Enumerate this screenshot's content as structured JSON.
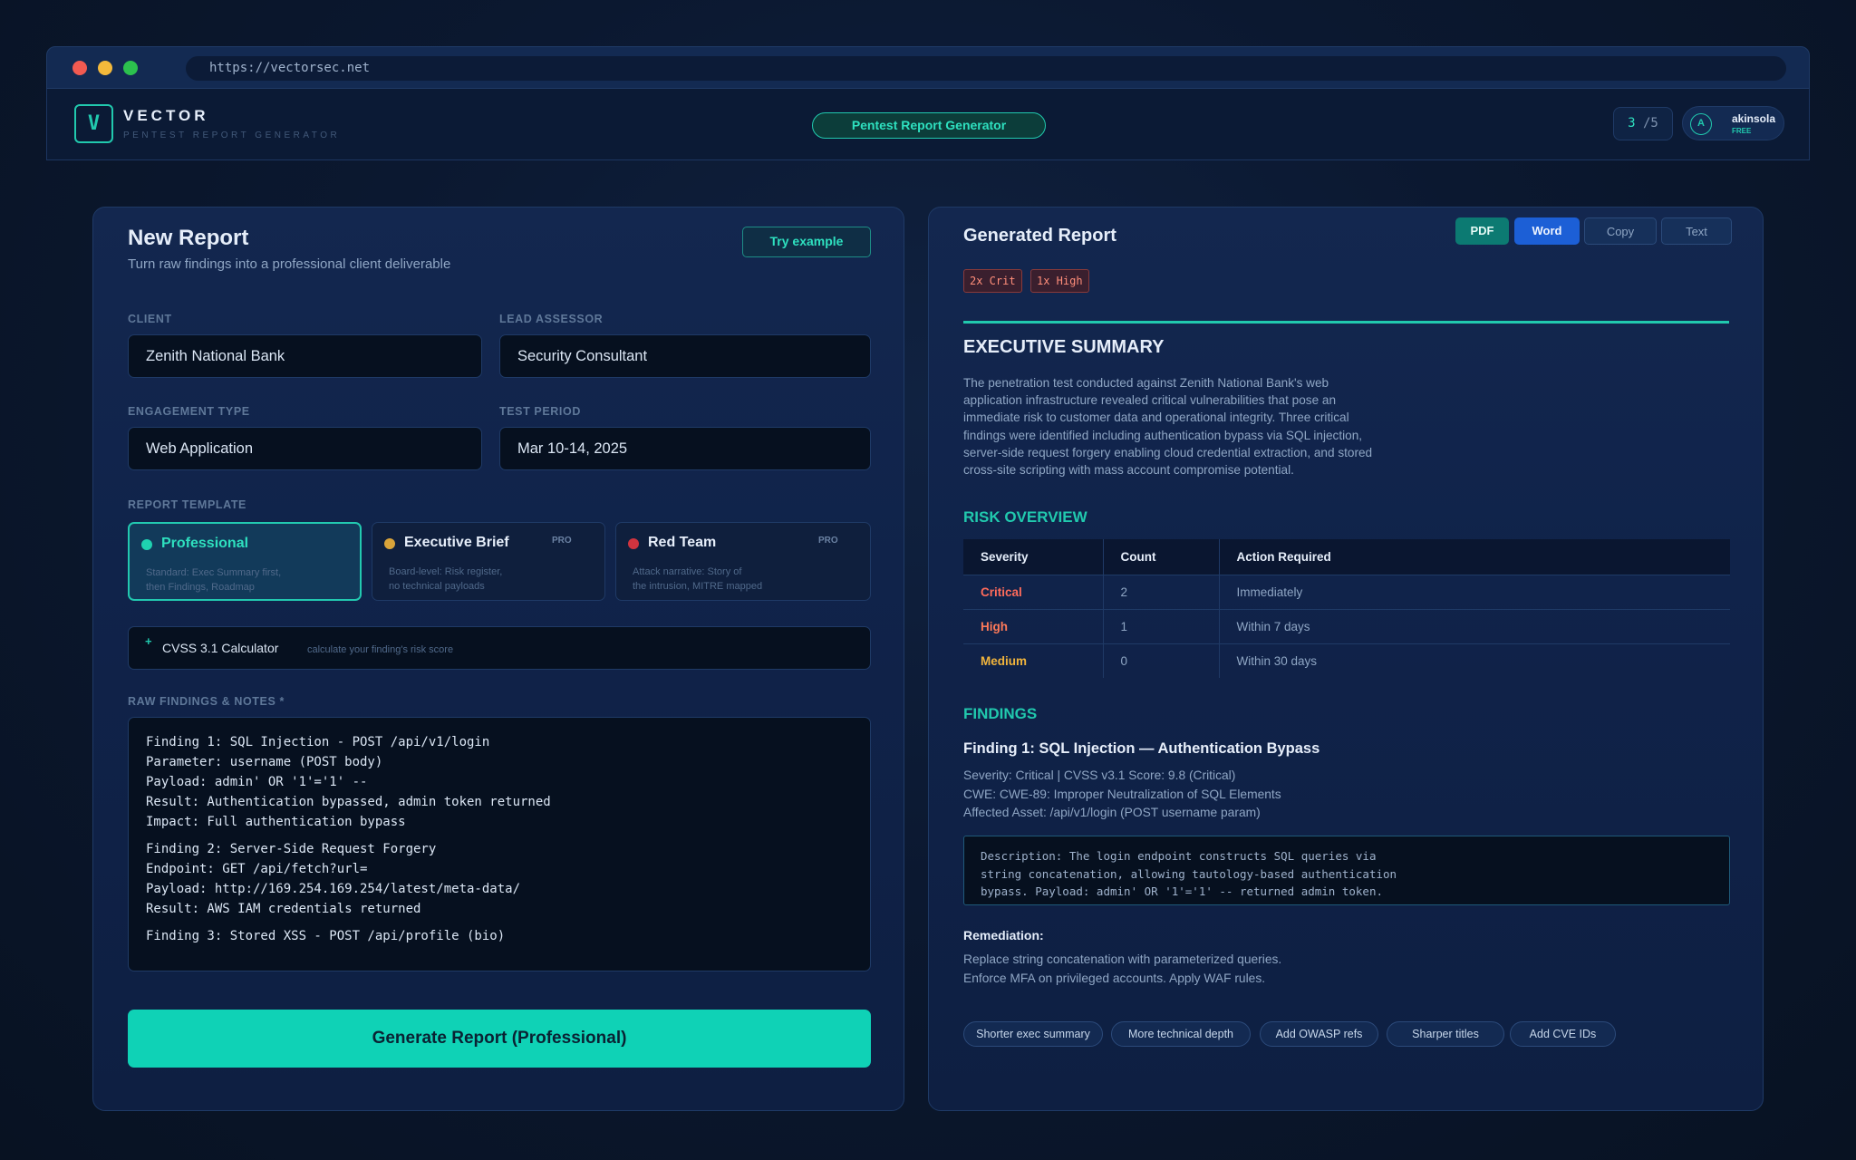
{
  "browser": {
    "url": "https://vectorsec.net"
  },
  "header": {
    "brand": "VECTOR",
    "brand_sub": "PENTEST REPORT GENERATOR",
    "logo_letter": "V",
    "center_title": "Pentest Report Generator",
    "credits_used": "3",
    "credits_total": "/5",
    "user_initial": "A",
    "user_name": "akinsola",
    "user_plan": "FREE"
  },
  "left": {
    "title": "New Report",
    "subtitle": "Turn raw findings into a professional client deliverable",
    "try_example": "Try example",
    "fields": {
      "client_label": "CLIENT",
      "client_value": "Zenith National Bank",
      "assessor_label": "LEAD ASSESSOR",
      "assessor_value": "Security Consultant",
      "engagement_label": "ENGAGEMENT TYPE",
      "engagement_value": "Web Application",
      "period_label": "TEST PERIOD",
      "period_value": "Mar 10-14, 2025"
    },
    "template_label": "REPORT TEMPLATE",
    "templates": [
      {
        "name": "Professional",
        "pro": "",
        "desc1": "Standard: Exec Summary first,",
        "desc2": "then Findings, Roadmap",
        "color": "#1fd1b0"
      },
      {
        "name": "Executive Brief",
        "pro": "PRO",
        "desc1": "Board-level: Risk register,",
        "desc2": "no technical payloads",
        "color": "#d9a43a"
      },
      {
        "name": "Red Team",
        "pro": "PRO",
        "desc1": "Attack narrative: Story of",
        "desc2": "the intrusion, MITRE mapped",
        "color": "#d0343f"
      }
    ],
    "cvss": {
      "plus": "+",
      "name": "CVSS 3.1 Calculator",
      "hint": "calculate your finding's risk score"
    },
    "notes_label": "RAW FINDINGS & NOTES *",
    "notes_lines": [
      "Finding 1: SQL Injection - POST /api/v1/login",
      "Parameter: username (POST body)",
      "Payload: admin' OR '1'='1' --",
      "Result: Authentication bypassed, admin token returned",
      "Impact: Full authentication bypass",
      "Finding 2: Server-Side Request Forgery",
      "Endpoint: GET /api/fetch?url=",
      "Payload: http://169.254.169.254/latest/meta-data/",
      "Result: AWS IAM credentials returned",
      "Finding 3: Stored XSS - POST /api/profile (bio)"
    ],
    "generate_button": "Generate Report (Professional)"
  },
  "right": {
    "title": "Generated Report",
    "exports": {
      "pdf": "PDF",
      "word": "Word",
      "copy": "Copy",
      "text": "Text"
    },
    "badges": {
      "crit": "2x Crit",
      "high": "1x High"
    },
    "exec_title": "EXECUTIVE SUMMARY",
    "exec_lines": [
      "The penetration test conducted against Zenith National Bank's web",
      "application infrastructure revealed critical vulnerabilities that pose an",
      "immediate risk to customer data and operational integrity. Three critical",
      "findings were identified including authentication bypass via SQL injection,",
      "server-side request forgery enabling cloud credential extraction, and stored",
      "cross-site scripting with mass account compromise potential."
    ],
    "risk_title": "RISK OVERVIEW",
    "risk_headers": {
      "severity": "Severity",
      "count": "Count",
      "action": "Action Required"
    },
    "risk_rows": [
      {
        "severity": "Critical",
        "count": "2",
        "action": "Immediately",
        "color": "#ff6b5b"
      },
      {
        "severity": "High",
        "count": "1",
        "action": "Within 7 days",
        "color": "#ff7a59"
      },
      {
        "severity": "Medium",
        "count": "0",
        "action": "Within 30 days",
        "color": "#f1b43c"
      }
    ],
    "findings_title": "FINDINGS",
    "finding1_title": "Finding 1: SQL Injection — Authentication Bypass",
    "finding1_meta": [
      "Severity: Critical | CVSS v3.1 Score: 9.8 (Critical)",
      "CWE: CWE-89: Improper Neutralization of SQL Elements",
      "Affected Asset: /api/v1/login (POST username param)"
    ],
    "desc_lines": [
      "Description: The login endpoint constructs SQL queries via",
      "string concatenation, allowing tautology-based authentication",
      "bypass. Payload: admin' OR '1'='1' -- returned admin token."
    ],
    "remediation_title": "Remediation:",
    "remediation_lines": [
      "Replace string concatenation with parameterized queries.",
      "Enforce MFA on privileged accounts. Apply WAF rules."
    ],
    "chips": [
      "Shorter exec summary",
      "More technical depth",
      "Add OWASP refs",
      "Sharper titles",
      "Add CVE IDs"
    ]
  }
}
